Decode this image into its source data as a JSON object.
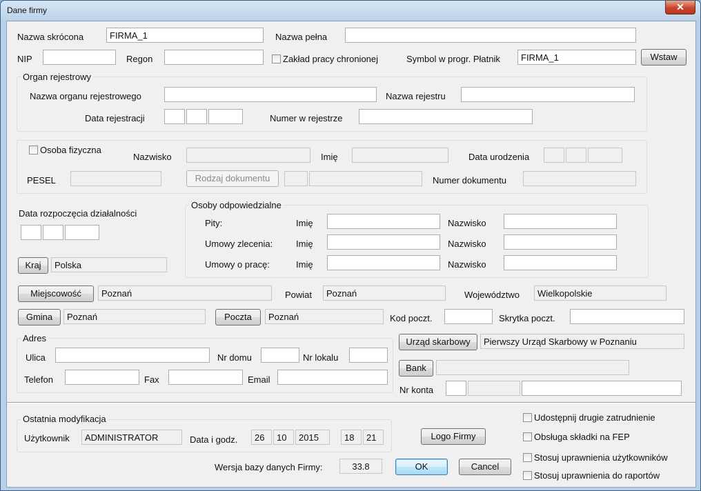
{
  "window": {
    "title": "Dane firmy",
    "close_glyph": "✕"
  },
  "firm": {
    "short_name_label": "Nazwa skrócona",
    "short_name_value": "FIRMA_1",
    "full_name_label": "Nazwa pełna",
    "full_name_value": "",
    "nip_label": "NIP",
    "regon_label": "Regon",
    "protected_label": "Zakład pracy chronionej",
    "symbol_label": "Symbol w progr. Płatnik",
    "symbol_value": "FIRMA_1",
    "insert_button": "Wstaw"
  },
  "registry": {
    "group_label": "Organ rejestrowy",
    "organ_name_label": "Nazwa organu rejestrowego",
    "registry_name_label": "Nazwa rejestru",
    "reg_date_label": "Data rejestracji",
    "reg_number_label": "Numer w rejestrze"
  },
  "person": {
    "checkbox_label": "Osoba fizyczna",
    "surname_label": "Nazwisko",
    "name_label": "Imię",
    "birth_date_label": "Data urodzenia",
    "pesel_label": "PESEL",
    "doc_type_button": "Rodzaj dokumentu",
    "doc_number_label": "Numer dokumentu"
  },
  "activity": {
    "start_label": "Data rozpoczęcia działalności",
    "country_button": "Kraj",
    "country_value": "Polska"
  },
  "responsible": {
    "group_label": "Osoby odpowiedzialne",
    "rows": [
      {
        "label": "Pity:",
        "name_label": "Imię",
        "surname_label": "Nazwisko"
      },
      {
        "label": "Umowy zlecenia:",
        "name_label": "Imię",
        "surname_label": "Nazwisko"
      },
      {
        "label": "Umowy o pracę:",
        "name_label": "Imię",
        "surname_label": "Nazwisko"
      }
    ]
  },
  "location": {
    "city_button": "Miejscowość",
    "city_value": "Poznań",
    "county_label": "Powiat",
    "county_value": "Poznań",
    "voivodeship_label": "Województwo",
    "voivodeship_value": "Wielkopolskie",
    "commune_button": "Gmina",
    "commune_value": "Poznań",
    "post_button": "Poczta",
    "post_value": "Poznań",
    "postal_code_label": "Kod poczt.",
    "pobox_label": "Skrytka poczt."
  },
  "address": {
    "group_label": "Adres",
    "street_label": "Ulica",
    "house_label": "Nr domu",
    "flat_label": "Nr lokalu",
    "phone_label": "Telefon",
    "fax_label": "Fax",
    "email_label": "Email"
  },
  "tax": {
    "office_button": "Urząd skarbowy",
    "office_value": "Pierwszy Urząd Skarbowy w Poznaniu",
    "bank_button": "Bank",
    "account_label": "Nr konta"
  },
  "modification": {
    "group_label": "Ostatnia modyfikacja",
    "user_label": "Użytkownik",
    "user_value": "ADMINISTRATOR",
    "datetime_label": "Data i godz.",
    "day": "26",
    "month": "10",
    "year": "2015",
    "hour": "18",
    "minute": "21"
  },
  "footer": {
    "logo_button": "Logo Firmy",
    "db_version_label": "Wersja bazy danych Firmy:",
    "db_version_value": "33.8",
    "ok_button": "OK",
    "cancel_button": "Cancel"
  },
  "options": [
    {
      "label": "Udostępnij drugie zatrudnienie"
    },
    {
      "label": "Obsługa składki na FEP"
    },
    {
      "label": "Stosuj uprawnienia użytkowników"
    },
    {
      "label": "Stosuj uprawnienia do raportów"
    }
  ]
}
